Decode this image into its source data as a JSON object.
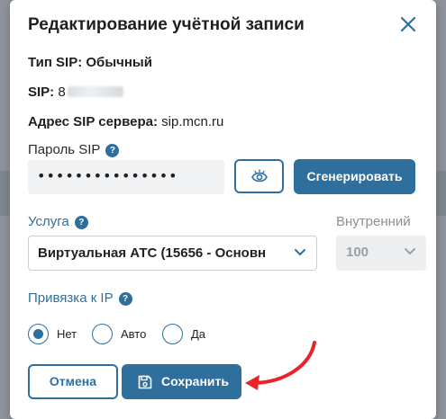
{
  "modal": {
    "title": "Редактирование учётной записи",
    "sip_type_label": "Тип SIP:",
    "sip_type_value": "Обычный",
    "sip_label": "SIP:",
    "sip_value_prefix": "8",
    "server_label": "Адрес SIP сервера:",
    "server_value": "sip.mcn.ru"
  },
  "password": {
    "label": "Пароль SIP",
    "value": "•••••••••••••••",
    "generate_label": "Сгенерировать"
  },
  "service": {
    "label": "Услуга",
    "selected": "Виртуальная АТС (15656 - Основн",
    "internal_label": "Внутренний",
    "internal_value": "100"
  },
  "ip_binding": {
    "label": "Привязка к IP",
    "options": [
      "Нет",
      "Авто",
      "Да"
    ],
    "selected": "Нет"
  },
  "actions": {
    "cancel_label": "Отмена",
    "save_label": "Сохранить"
  },
  "colors": {
    "accent": "#2f6f9e",
    "annotation_arrow": "#e8242a"
  },
  "icons": {
    "close": "close-icon",
    "help": "help-icon",
    "eye": "eye-icon",
    "chevron": "chevron-down-icon",
    "save": "floppy-disk-icon"
  }
}
